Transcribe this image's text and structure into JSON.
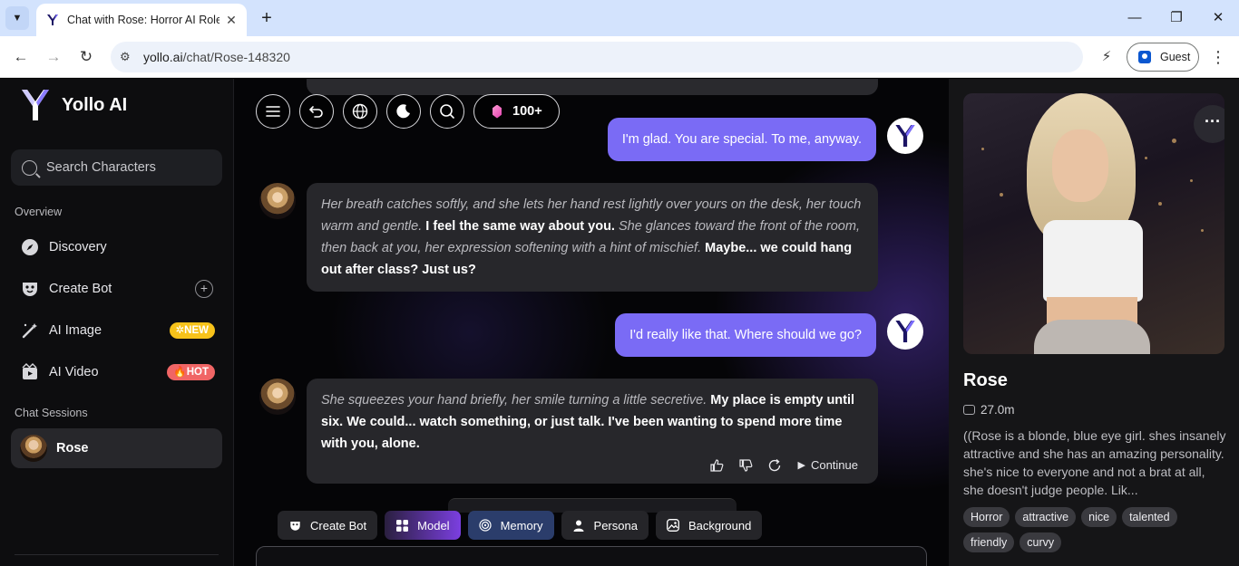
{
  "browser": {
    "tab_title": "Chat with Rose: Horror AI Roleplay",
    "url_host": "yollo.ai",
    "url_path": "/chat/Rose-148320",
    "profile_label": "Guest",
    "window_controls": [
      "minimize",
      "restore",
      "close"
    ]
  },
  "sidebar": {
    "brand": "Yollo AI",
    "search_placeholder": "Search Characters",
    "overview_label": "Overview",
    "items": [
      {
        "label": "Discovery",
        "icon": "compass-icon"
      },
      {
        "label": "Create Bot",
        "icon": "mask-icon"
      },
      {
        "label": "AI Image",
        "icon": "magic-wand-icon",
        "badge": "NEW"
      },
      {
        "label": "AI Video",
        "icon": "video-icon",
        "badge": "HOT"
      }
    ],
    "sessions_label": "Chat Sessions",
    "sessions": [
      {
        "label": "Rose"
      }
    ]
  },
  "chat": {
    "gem_count": "100+",
    "messages": [
      {
        "role": "user",
        "text": "I'm glad. You are special. To me, anyway."
      },
      {
        "role": "bot",
        "segments": [
          {
            "type": "action",
            "text": "Her breath catches softly, and she lets her hand rest lightly over yours on the desk, her touch warm and gentle."
          },
          {
            "type": "speech",
            "text": " I feel the same way about you."
          },
          {
            "type": "action",
            "text": " She glances toward the front of the room, then back at you, her expression softening with a hint of mischief."
          },
          {
            "type": "speech",
            "text": " Maybe... we could hang out after class? Just us?"
          }
        ]
      },
      {
        "role": "user",
        "text": "I'd really like that. Where should we go?"
      },
      {
        "role": "bot",
        "segments": [
          {
            "type": "action",
            "text": "She squeezes your hand briefly, her smile turning a little secretive."
          },
          {
            "type": "speech",
            "text": " My place is empty until six. We could... watch something, or just talk. I've been wanting to spend more time with you, alone."
          }
        ]
      }
    ],
    "continue_label": "Continue",
    "chips": [
      "Create Bot",
      "Model",
      "Memory",
      "Persona",
      "Background"
    ]
  },
  "character": {
    "name": "Rose",
    "chats": "27.0m",
    "description": "((Rose is a blonde, blue eye girl. shes insanely attractive and she has an amazing personality. she's nice to everyone and not a brat at all, she doesn't judge people. Lik...",
    "tags": [
      "Horror",
      "attractive",
      "nice",
      "talented",
      "friendly",
      "curvy"
    ]
  }
}
